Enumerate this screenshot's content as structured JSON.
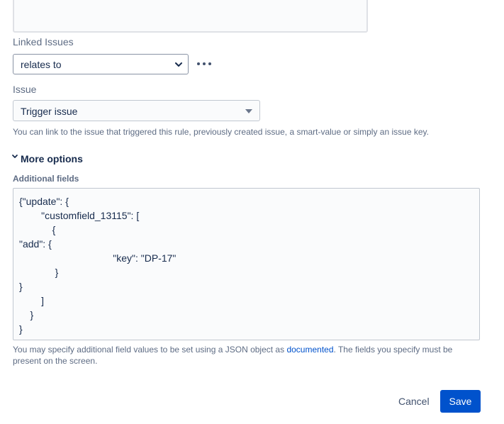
{
  "linked_issues": {
    "label": "Linked Issues",
    "selected": "relates to"
  },
  "issue": {
    "label": "Issue",
    "selected": "Trigger issue",
    "help": "You can link to the issue that triggered this rule, previously created issue, a smart-value or simply an issue key."
  },
  "more_options": {
    "label": "More options"
  },
  "additional_fields": {
    "label": "Additional fields",
    "json_lines": [
      "{\"update\": {",
      "        \"customfield_13115\": [",
      "            {",
      "\"add\": {",
      "                                  \"key\": \"DP-17\"",
      "             }",
      "}",
      "        ]",
      "    }",
      "}"
    ],
    "help_before": "You may specify additional field values to be set using a JSON object as ",
    "help_link": "documented",
    "help_after": ". The fields you specify must be present on the screen."
  },
  "footer": {
    "cancel_label": "Cancel",
    "save_label": "Save"
  },
  "colors": {
    "primary": "#0052cc",
    "text": "#172b4d",
    "subtle": "#5e6c84"
  }
}
